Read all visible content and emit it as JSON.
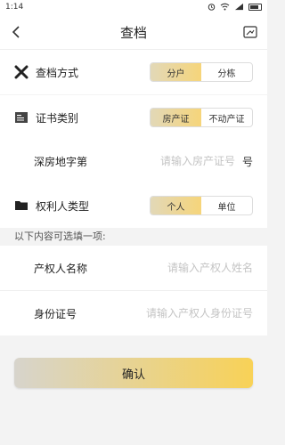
{
  "status_bar": {
    "time": "1:14",
    "icons": [
      "alarm-icon",
      "wifi-icon",
      "signal-icon",
      "battery-icon"
    ]
  },
  "header": {
    "back_icon": "back-arrow-icon",
    "title": "查档",
    "action_icon": "edit-icon"
  },
  "query_method": {
    "label": "查档方式",
    "icon": "cross-tools-icon",
    "options": [
      "分户",
      "分栋"
    ],
    "selected": "分户"
  },
  "certificate_type": {
    "label": "证书类别",
    "icon": "certificate-icon",
    "options": [
      "房产证",
      "不动产证"
    ],
    "selected": "房产证"
  },
  "property_number": {
    "label": "深房地字第",
    "placeholder": "请输入房产证号",
    "suffix": "号"
  },
  "owner_type": {
    "label": "权利人类型",
    "icon": "folder-icon",
    "options": [
      "个人",
      "单位"
    ],
    "selected": "个人"
  },
  "optional_hint": "以下内容可选填一项:",
  "owner_name": {
    "label": "产权人名称",
    "placeholder": "请输入产权人姓名"
  },
  "id_number": {
    "label": "身份证号",
    "placeholder": "请输入产权人身份证号"
  },
  "confirm_label": "确认",
  "colors": {
    "accent_start": "#e2d8b8",
    "accent_end": "#f6d57a",
    "button_gradient_end": "#f8d257"
  }
}
